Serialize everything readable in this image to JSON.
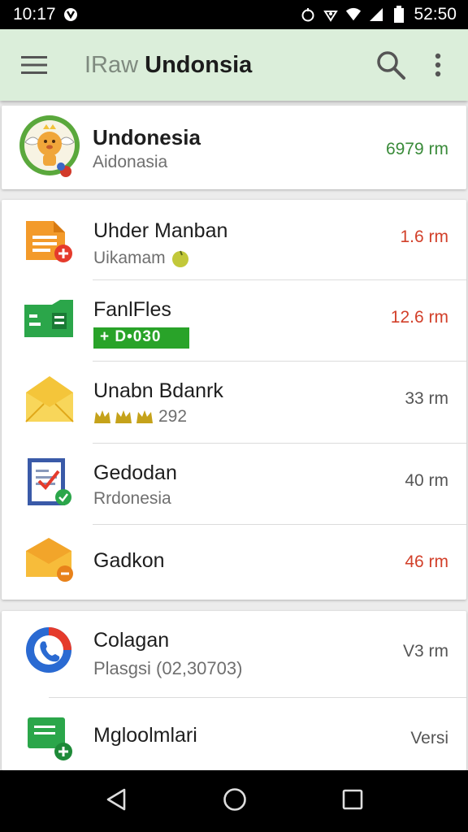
{
  "status_bar": {
    "time": "10:17",
    "clock": "52:50"
  },
  "toolbar": {
    "title_prefix": "IRaw",
    "title": "Undonsia"
  },
  "profile": {
    "name": "Undonesia",
    "subtitle": "Aidonasia",
    "value": "6979 rm",
    "value_color": "#3a8b3a"
  },
  "list": [
    {
      "title": "Uhder Manban",
      "subtitle": "Uikamam",
      "value": "1.6 rm",
      "value_color": "#d2402a"
    },
    {
      "title": "FanlFles",
      "badge": "+ D•030",
      "value": "12.6 rm",
      "value_color": "#d2402a"
    },
    {
      "title": "Unabn Bdanrk",
      "subtitle": "292",
      "value": "33 rm",
      "value_color": "#555555"
    },
    {
      "title": "Gedodan",
      "subtitle": "Rrdonesia",
      "value": "40 rm",
      "value_color": "#555555"
    },
    {
      "title": "Gadkon",
      "value": "46 rm",
      "value_color": "#d2402a"
    }
  ],
  "list2": [
    {
      "title": "Colagan",
      "subtitle": "Plasgsi (02,30703)",
      "value": "V3 rm",
      "value_color": "#555555"
    },
    {
      "title": "Mgloolmlari",
      "value": "Versi",
      "value_color": "#555555"
    }
  ]
}
